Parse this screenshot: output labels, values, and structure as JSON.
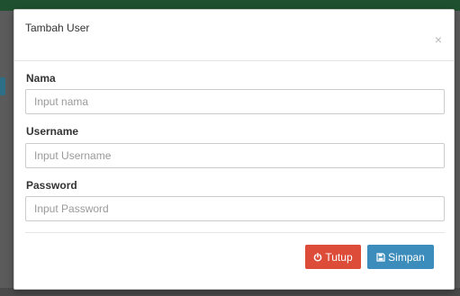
{
  "modal": {
    "title": "Tambah User",
    "close_symbol": "×"
  },
  "form": {
    "nama": {
      "label": "Nama",
      "placeholder": "Input nama",
      "value": ""
    },
    "username": {
      "label": "Username",
      "placeholder": "Input Username",
      "value": ""
    },
    "password": {
      "label": "Password",
      "placeholder": "Input Password",
      "value": ""
    }
  },
  "footer": {
    "close_label": "Tutup",
    "save_label": "Simpan",
    "close_icon": "power-icon",
    "save_icon": "floppy-disk-icon"
  },
  "colors": {
    "danger": "#dd4b39",
    "primary": "#3c8dbc",
    "topbar": "#1f5130"
  }
}
